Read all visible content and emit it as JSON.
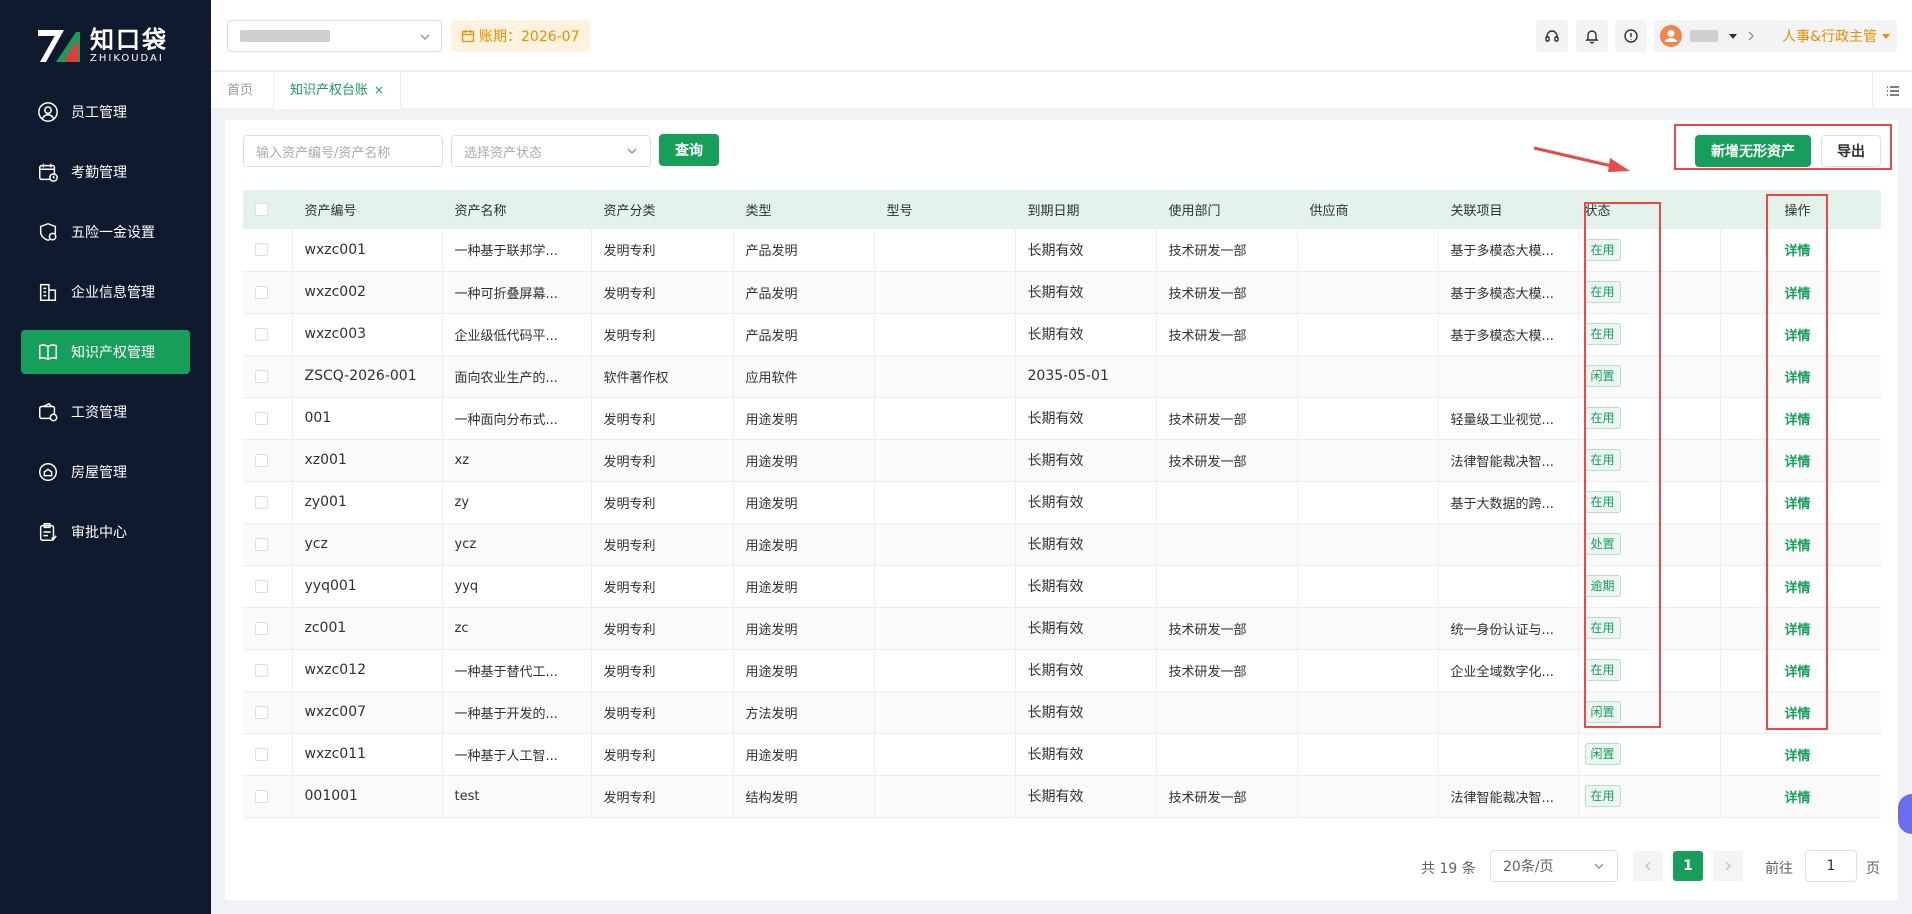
{
  "brand": {
    "name_cn": "知口袋",
    "name_en": "ZHIKOUDAI",
    "accent": "#169e5a"
  },
  "sidebar": {
    "items": [
      {
        "label": "员工管理",
        "icon": "user-icon"
      },
      {
        "label": "考勤管理",
        "icon": "calendar-clock-icon"
      },
      {
        "label": "五险一金设置",
        "icon": "shield-gear-icon"
      },
      {
        "label": "企业信息管理",
        "icon": "building-icon"
      },
      {
        "label": "知识产权管理",
        "icon": "book-icon",
        "active": true
      },
      {
        "label": "工资管理",
        "icon": "wallet-icon"
      },
      {
        "label": "房屋管理",
        "icon": "house-icon"
      },
      {
        "label": "审批中心",
        "icon": "clipboard-icon"
      }
    ]
  },
  "topbar": {
    "period": "账期：2026-07",
    "role": "人事&行政主管"
  },
  "tabs": {
    "home": "首页",
    "active": "知识产权台账",
    "close": "×"
  },
  "toolbar": {
    "search_placeholder": "输入资产编号/资产名称",
    "status_placeholder": "选择资产状态",
    "query": "查询",
    "add": "新增无形资产",
    "export": "导出"
  },
  "table": {
    "columns": [
      "资产编号",
      "资产名称",
      "资产分类",
      "类型",
      "型号",
      "到期日期",
      "使用部门",
      "供应商",
      "关联项目",
      "状态",
      "操作"
    ],
    "rows": [
      {
        "code": "wxzc001",
        "name": "一种基于联邦学...",
        "category": "发明专利",
        "type": "产品发明",
        "model": "",
        "expiry": "长期有效",
        "dept": "技术研发一部",
        "supplier": "",
        "project": "基于多模态大模...",
        "status": "在用",
        "action": "详情"
      },
      {
        "code": "wxzc002",
        "name": "一种可折叠屏幕...",
        "category": "发明专利",
        "type": "产品发明",
        "model": "",
        "expiry": "长期有效",
        "dept": "技术研发一部",
        "supplier": "",
        "project": "基于多模态大模...",
        "status": "在用",
        "action": "详情"
      },
      {
        "code": "wxzc003",
        "name": "企业级低代码平...",
        "category": "发明专利",
        "type": "产品发明",
        "model": "",
        "expiry": "长期有效",
        "dept": "技术研发一部",
        "supplier": "",
        "project": "基于多模态大模...",
        "status": "在用",
        "action": "详情"
      },
      {
        "code": "ZSCQ-2026-001",
        "name": "面向农业生产的...",
        "category": "软件著作权",
        "type": "应用软件",
        "model": "",
        "expiry": "2035-05-01",
        "dept": "",
        "supplier": "",
        "project": "",
        "status": "闲置",
        "action": "详情"
      },
      {
        "code": "001",
        "name": "一种面向分布式...",
        "category": "发明专利",
        "type": "用途发明",
        "model": "",
        "expiry": "长期有效",
        "dept": "技术研发一部",
        "supplier": "",
        "project": "轻量级工业视觉...",
        "status": "在用",
        "action": "详情"
      },
      {
        "code": "xz001",
        "name": "xz",
        "category": "发明专利",
        "type": "用途发明",
        "model": "",
        "expiry": "长期有效",
        "dept": "技术研发一部",
        "supplier": "",
        "project": "法律智能裁决智...",
        "status": "在用",
        "action": "详情"
      },
      {
        "code": "zy001",
        "name": "zy",
        "category": "发明专利",
        "type": "用途发明",
        "model": "",
        "expiry": "长期有效",
        "dept": "",
        "supplier": "",
        "project": "基于大数据的跨...",
        "status": "在用",
        "action": "详情"
      },
      {
        "code": "ycz",
        "name": "ycz",
        "category": "发明专利",
        "type": "用途发明",
        "model": "",
        "expiry": "长期有效",
        "dept": "",
        "supplier": "",
        "project": "",
        "status": "处置",
        "action": "详情"
      },
      {
        "code": "yyq001",
        "name": "yyq",
        "category": "发明专利",
        "type": "用途发明",
        "model": "",
        "expiry": "长期有效",
        "dept": "",
        "supplier": "",
        "project": "",
        "status": "逾期",
        "action": "详情"
      },
      {
        "code": "zc001",
        "name": "zc",
        "category": "发明专利",
        "type": "用途发明",
        "model": "",
        "expiry": "长期有效",
        "dept": "技术研发一部",
        "supplier": "",
        "project": "统一身份认证与...",
        "status": "在用",
        "action": "详情"
      },
      {
        "code": "wxzc012",
        "name": "一种基于替代工...",
        "category": "发明专利",
        "type": "用途发明",
        "model": "",
        "expiry": "长期有效",
        "dept": "技术研发一部",
        "supplier": "",
        "project": "企业全域数字化...",
        "status": "在用",
        "action": "详情"
      },
      {
        "code": "wxzc007",
        "name": "一种基于开发的...",
        "category": "发明专利",
        "type": "方法发明",
        "model": "",
        "expiry": "长期有效",
        "dept": "",
        "supplier": "",
        "project": "",
        "status": "闲置",
        "action": "详情"
      },
      {
        "code": "wxzc011",
        "name": "一种基于人工智...",
        "category": "发明专利",
        "type": "用途发明",
        "model": "",
        "expiry": "长期有效",
        "dept": "",
        "supplier": "",
        "project": "",
        "status": "闲置",
        "action": "详情"
      },
      {
        "code": "001001",
        "name": "test",
        "category": "发明专利",
        "type": "结构发明",
        "model": "",
        "expiry": "长期有效",
        "dept": "技术研发一部",
        "supplier": "",
        "project": "法律智能裁决智...",
        "status": "在用",
        "action": "详情"
      }
    ]
  },
  "pagination": {
    "total": "共 19 条",
    "page_size": "20条/页",
    "current_page": "1",
    "goto_label": "前往",
    "goto_value": "1",
    "page_suffix": "页"
  }
}
